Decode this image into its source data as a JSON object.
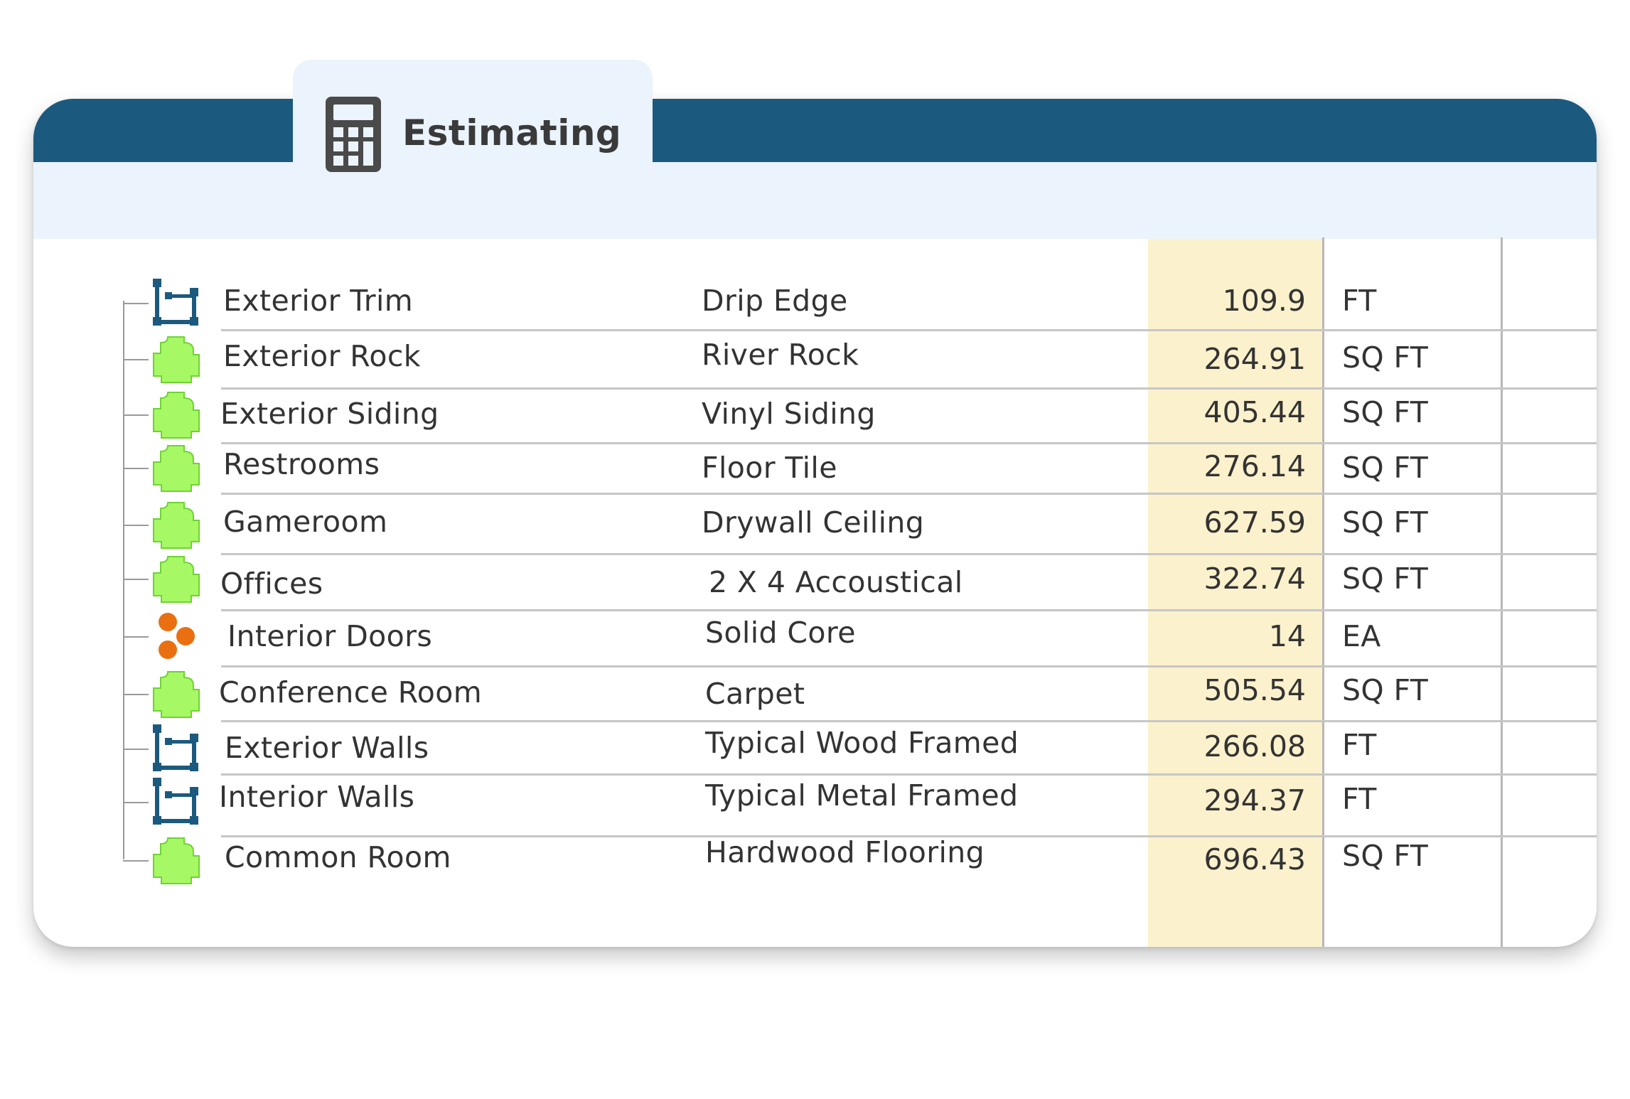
{
  "tab": {
    "label": "Estimating",
    "icon": "calculator-icon"
  },
  "colors": {
    "header": "#1b5a7e",
    "subheader": "#ebf3fd",
    "quantity_column": "#fbf1cc",
    "area_icon": "#a6f865",
    "linear_icon": "#1b5a7e",
    "count_icon": "#ea6f10"
  },
  "rows": [
    {
      "name": "Exterior Trim",
      "material": "Drip Edge",
      "quantity": "109.9",
      "unit": "FT",
      "icon": "linear-measure-icon"
    },
    {
      "name": "Exterior Rock",
      "material": "River Rock",
      "quantity": "264.91",
      "unit": "SQ FT",
      "icon": "area-measure-icon"
    },
    {
      "name": "Exterior Siding",
      "material": "Vinyl Siding",
      "quantity": "405.44",
      "unit": "SQ FT",
      "icon": "area-measure-icon"
    },
    {
      "name": "Restrooms",
      "material": "Floor Tile",
      "quantity": "276.14",
      "unit": "SQ FT",
      "icon": "area-measure-icon"
    },
    {
      "name": "Gameroom",
      "material": "Drywall Ceiling",
      "quantity": "627.59",
      "unit": "SQ FT",
      "icon": "area-measure-icon"
    },
    {
      "name": "Offices",
      "material": "2 X 4 Accoustical",
      "quantity": "322.74",
      "unit": "SQ FT",
      "icon": "area-measure-icon"
    },
    {
      "name": "Interior Doors",
      "material": "Solid Core",
      "quantity": "14",
      "unit": "EA",
      "icon": "count-measure-icon"
    },
    {
      "name": "Conference Room",
      "material": "Carpet",
      "quantity": "505.54",
      "unit": "SQ FT",
      "icon": "area-measure-icon"
    },
    {
      "name": "Exterior Walls",
      "material": "Typical Wood Framed",
      "quantity": "266.08",
      "unit": "FT",
      "icon": "linear-measure-icon"
    },
    {
      "name": "Interior Walls",
      "material": "Typical Metal Framed",
      "quantity": "294.37",
      "unit": "FT",
      "icon": "linear-measure-icon"
    },
    {
      "name": "Common Room",
      "material": "Hardwood Flooring",
      "quantity": "696.43",
      "unit": "SQ FT",
      "icon": "area-measure-icon"
    }
  ]
}
